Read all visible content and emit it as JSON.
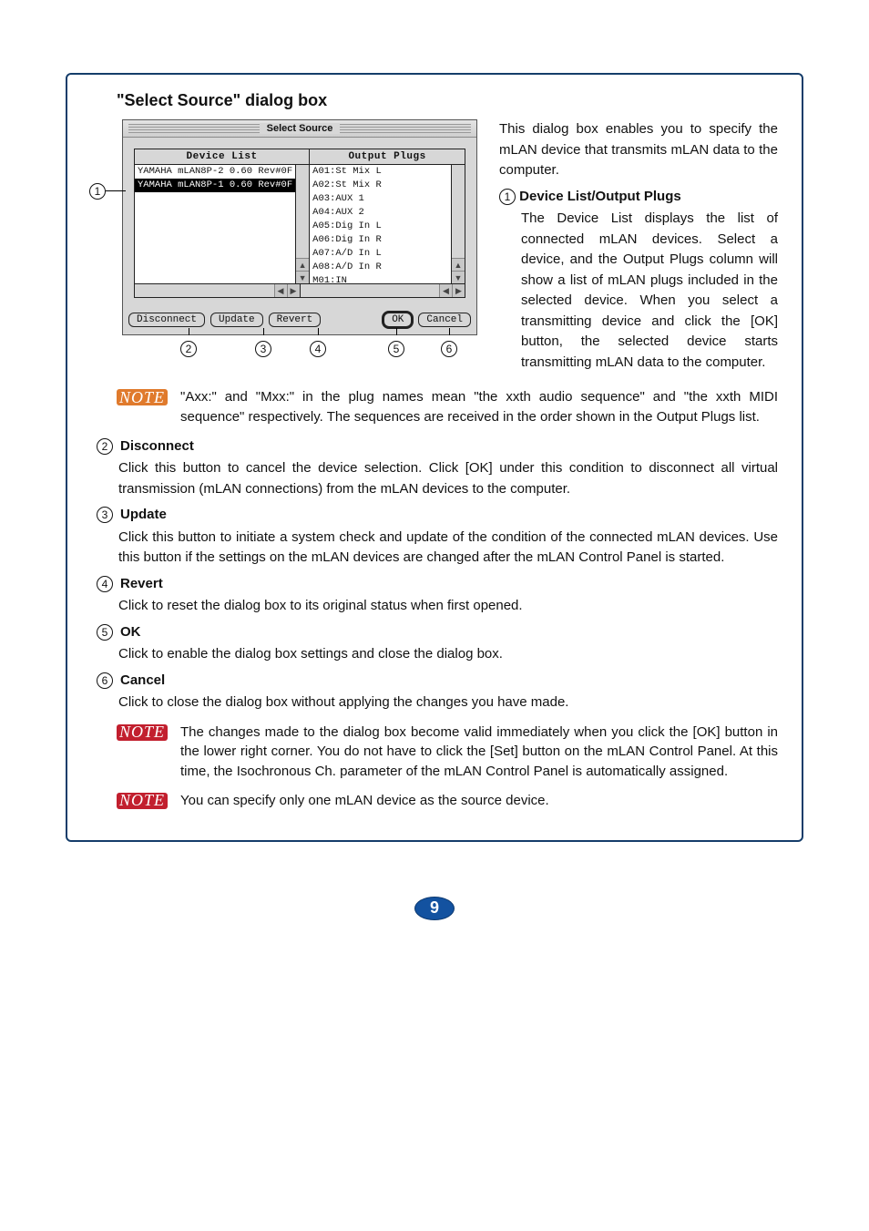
{
  "section_title": "\"Select Source\" dialog box",
  "dialog": {
    "title": "Select Source",
    "device_list_header": "Device List",
    "output_plugs_header": "Output Plugs",
    "devices": [
      "YAMAHA mLAN8P-2  0.60 Rev#0F",
      "YAMAHA mLAN8P-1  0.60 Rev#0F"
    ],
    "selected_device_index": 1,
    "plugs": [
      "A01:St Mix L",
      "A02:St Mix R",
      "A03:AUX 1",
      "A04:AUX 2",
      "A05:Dig In L",
      "A06:Dig In R",
      "A07:A/D In L",
      "A08:A/D In R",
      "M01:IN"
    ],
    "buttons": {
      "disconnect": "Disconnect",
      "update": "Update",
      "revert": "Revert",
      "ok": "OK",
      "cancel": "Cancel"
    }
  },
  "intro_text": "This dialog box enables you to specify the mLAN device that transmits mLAN data to the computer.",
  "item1": {
    "num": "1",
    "title": "Device List/Output Plugs",
    "body": "The Device List displays the list of connected mLAN devices. Select a device, and the Output Plugs column will show a list of mLAN plugs included in the selected device. When you select a transmitting device and click the [OK] button, the selected device starts transmitting mLAN data to the computer."
  },
  "note1": "\"Axx:\" and \"Mxx:\" in the plug names mean \"the xxth audio sequence\" and \"the xxth MIDI sequence\" respectively. The sequences are received in the order shown in the Output Plugs list.",
  "items": {
    "i2": {
      "num": "2",
      "title": "Disconnect",
      "body": "Click this button to cancel the device selection. Click [OK] under this condition to disconnect all virtual transmission (mLAN connections) from the mLAN devices to the computer."
    },
    "i3": {
      "num": "3",
      "title": "Update",
      "body": "Click this button to initiate a system check and update of the condition of the connected mLAN devices. Use this button if the settings on the mLAN devices are changed after the mLAN Control Panel is started."
    },
    "i4": {
      "num": "4",
      "title": "Revert",
      "body": "Click to reset the dialog box to its original status when first opened."
    },
    "i5": {
      "num": "5",
      "title": "OK",
      "body": "Click to enable the dialog box settings and close the dialog box."
    },
    "i6": {
      "num": "6",
      "title": "Cancel",
      "body": "Click to close the dialog box without applying the changes you have made."
    }
  },
  "note2": "The changes made to the dialog box become valid immediately when you click the [OK] button in the lower right corner. You do not have to click the [Set] button on the mLAN Control Panel. At this time, the Isochronous Ch. parameter of the mLAN Control Panel is automatically assigned.",
  "note3": "You can specify only one mLAN device as the source device.",
  "note_label": "NOTE",
  "page_number": "9"
}
